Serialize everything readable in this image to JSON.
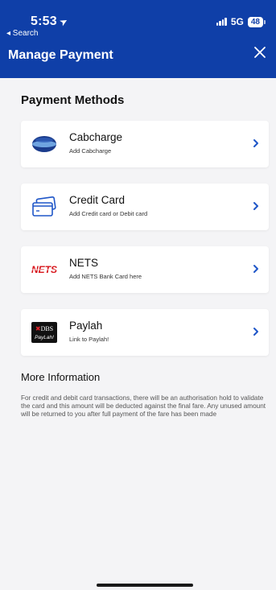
{
  "status_bar": {
    "time": "5:53",
    "back_app": "◂ Search",
    "network": "5G",
    "battery": "48"
  },
  "header": {
    "title": "Manage Payment"
  },
  "payment_methods": {
    "section_title": "Payment Methods",
    "items": [
      {
        "title": "Cabcharge",
        "subtitle": "Add Cabcharge",
        "logo_text": "cabcharge"
      },
      {
        "title": "Credit Card",
        "subtitle": "Add Credit card or Debit card"
      },
      {
        "title": "NETS",
        "subtitle": "Add NETS Bank Card here",
        "logo_text": "NETS"
      },
      {
        "title": "Paylah",
        "subtitle": "Link to Paylah!",
        "logo_text_top": "DBS",
        "logo_text_bottom": "PayLah!"
      }
    ]
  },
  "more_info": {
    "title": "More Information",
    "text": "For credit and debit card transactions, there will be an authorisation hold to validate the card and this amount will be deducted against the final fare. Any unused amount will be returned to you after full payment of the fare has been made"
  },
  "colors": {
    "brand_blue": "#0f3fa8",
    "chevron_blue": "#1f56c8",
    "nets_red": "#d7141a"
  }
}
